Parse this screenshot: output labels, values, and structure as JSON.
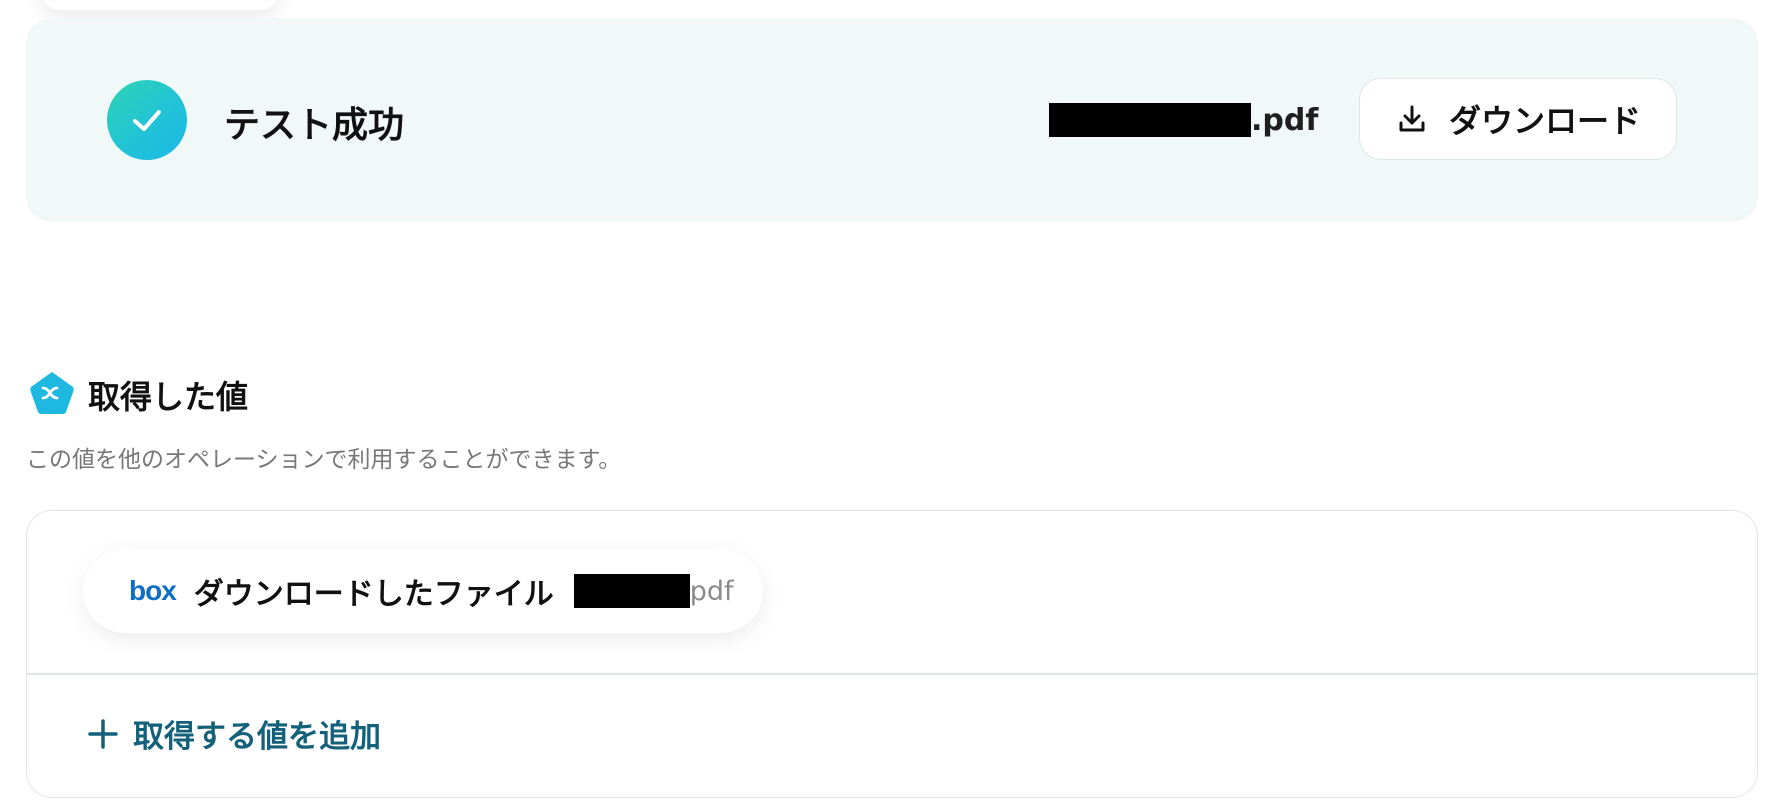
{
  "result": {
    "status_label": "テスト成功",
    "filename_suffix": ".pdf",
    "download_label": "ダウンロード"
  },
  "fetched_values": {
    "title": "取得した値",
    "description": "この値を他のオペレーションで利用することができます。",
    "items": [
      {
        "service_logo": "box",
        "label": "ダウンロードしたファイル",
        "value_suffix": "pdf"
      }
    ],
    "add_label": "取得する値を追加"
  },
  "colors": {
    "success_gradient_start": "#2dd4b4",
    "success_gradient_end": "#1ab8e8",
    "panel_background": "#f1f8f8",
    "accent_teal": "#13607a",
    "box_blue": "#0b6fc7",
    "variable_icon": "#1fb8e0"
  },
  "icons": {
    "success": "check-icon",
    "download": "download-icon",
    "variable": "variable-pentagon-icon",
    "add": "plus-icon"
  }
}
